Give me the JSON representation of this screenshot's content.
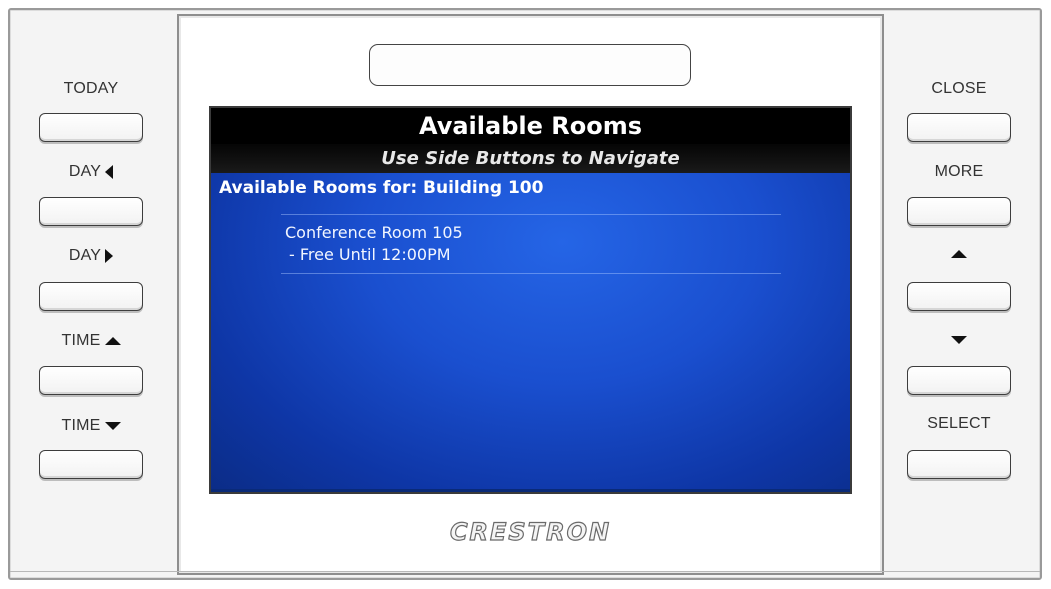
{
  "left_buttons": [
    {
      "label": "TODAY",
      "icon": ""
    },
    {
      "label": "DAY",
      "icon": "triangle-left-icon"
    },
    {
      "label": "DAY",
      "icon": "triangle-right-icon"
    },
    {
      "label": "TIME",
      "icon": "triangle-up-icon"
    },
    {
      "label": "TIME",
      "icon": "triangle-down-icon"
    }
  ],
  "right_buttons": [
    {
      "label": "CLOSE",
      "icon": ""
    },
    {
      "label": "MORE",
      "icon": ""
    },
    {
      "label": "",
      "icon": "triangle-up-icon"
    },
    {
      "label": "",
      "icon": "triangle-down-icon"
    },
    {
      "label": "SELECT",
      "icon": ""
    }
  ],
  "screen": {
    "title": "Available Rooms",
    "subtitle": "Use Side Buttons to Navigate",
    "building_header": "Available Rooms for: Building 100",
    "rooms": [
      {
        "name": "Conference Room 105",
        "status": "- Free Until 12:00PM"
      }
    ]
  },
  "brand": "CRESTRON",
  "colors": {
    "screen_blue": "#1a4fcf",
    "title_bar": "#000000",
    "bezel": "#ffffff",
    "frame": "#f4f4f4"
  }
}
